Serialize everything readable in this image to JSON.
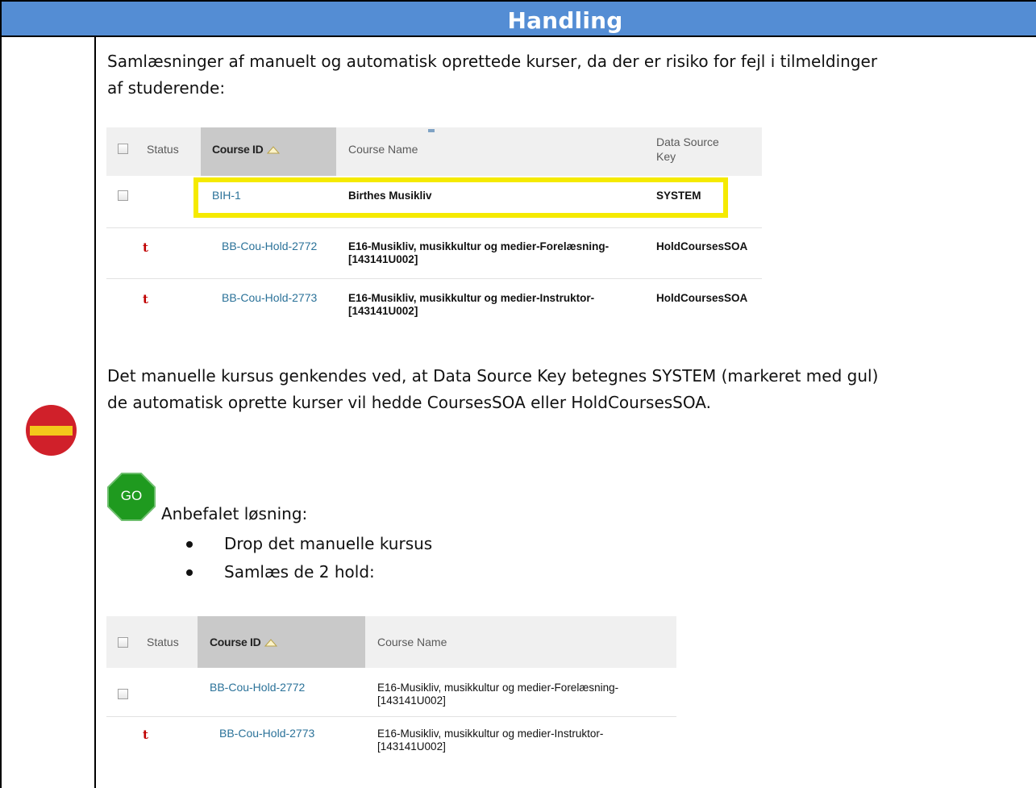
{
  "header": {
    "title": "Handling"
  },
  "intro_text": {
    "line1": "Samlæsninger af manuelt og automatisk oprettede kurser, da der er risiko for fejl i tilmeldinger",
    "line2": "af studerende:"
  },
  "table1": {
    "columns": [
      "Status",
      "Course ID",
      "Course Name",
      "Data Source",
      "Key"
    ],
    "rows": [
      {
        "course_id": "BIH-1",
        "course_name_1": "Birthes Musikliv",
        "course_name_2": "",
        "data_source_key": "SYSTEM"
      },
      {
        "status_icon": "t",
        "course_id": "BB-Cou-Hold-2772",
        "course_name_1": "E16-Musikliv, musikkultur og medier-Forelæsning-",
        "course_name_2": "[143141U002]",
        "data_source_key": "HoldCoursesSOA"
      },
      {
        "status_icon": "t",
        "course_id": "BB-Cou-Hold-2773",
        "course_name_1": "E16-Musikliv, musikkultur og medier-Instruktor-",
        "course_name_2": "[143141U002]",
        "data_source_key": "HoldCoursesSOA"
      }
    ]
  },
  "explanation": {
    "line1": "Det manuelle kursus genkendes ved, at Data Source Key betegnes SYSTEM (markeret med gul)",
    "line2": "de automatisk oprette kurser vil hedde CoursesSOA eller HoldCoursesSOA."
  },
  "recommendation": {
    "go_label": "GO",
    "title": "Anbefalet løsning:",
    "bullets": [
      "Drop det manuelle kursus",
      "Samlæs de 2 hold:"
    ]
  },
  "table2": {
    "columns": [
      "Status",
      "Course ID",
      "Course Name"
    ],
    "rows": [
      {
        "course_id": "BB-Cou-Hold-2772",
        "course_name_1": "E16-Musikliv, musikkultur og medier-Forelæsning-",
        "course_name_2": "[143141U002]"
      },
      {
        "status_icon": "t",
        "course_id": "BB-Cou-Hold-2773",
        "course_name_1": "E16-Musikliv, musikkultur og medier-Instruktor-",
        "course_name_2": "[143141U002]"
      }
    ]
  },
  "colors": {
    "header_blue": "#548dd4",
    "highlight_yellow": "#f5ea00",
    "noentry_red": "#d0202a",
    "go_green": "#1f9a1f",
    "link_blue": "#2b7299"
  }
}
